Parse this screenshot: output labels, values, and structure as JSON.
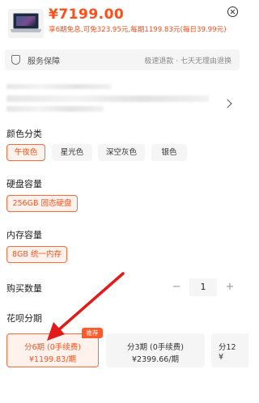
{
  "product": {
    "price": "¥7199.00",
    "promo": "享6期免息,可免323.95元,每期1199.83元(每日39.99元)"
  },
  "service": {
    "title": "服务保障",
    "description": "极速退款 · 七天无理由退换"
  },
  "sections": {
    "color": "颜色分类",
    "storage": "硬盘容量",
    "memory": "内存容量",
    "quantity": "购买数量",
    "installment": "花呗分期"
  },
  "colors": [
    "午夜色",
    "星光色",
    "深空灰色",
    "银色"
  ],
  "selected_color": "午夜色",
  "storage_option": "256GB 固态硬盘",
  "memory_option": "8GB 统一内存",
  "quantity": {
    "minus": "−",
    "value": "1",
    "plus": "+"
  },
  "installments": [
    {
      "title": "分6期 (0手续费)",
      "amount": "¥1199.83/期",
      "selected": true
    },
    {
      "title": "分3期 (0手续费)",
      "amount": "¥2399.66/期",
      "selected": false
    },
    {
      "title": "分12",
      "amount": "¥",
      "selected": false
    }
  ],
  "recommend_badge": "推荐",
  "accent_color": "#ff4e1a",
  "annotation_color": "#e4191a"
}
